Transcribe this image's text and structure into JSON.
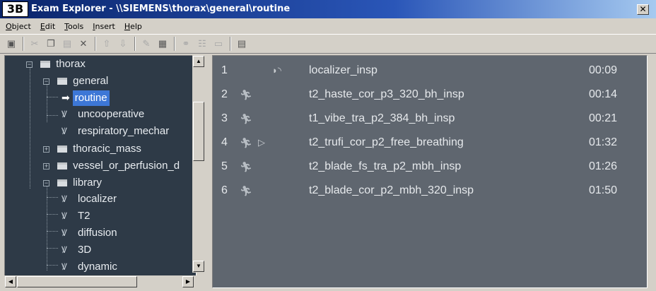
{
  "figure_label": "3B",
  "window": {
    "title": "Exam Explorer - \\\\SIEMENS\\thorax\\general\\routine",
    "close_label": "✕"
  },
  "menu": [
    "Object",
    "Edit",
    "Tools",
    "Insert",
    "Help"
  ],
  "tree": {
    "items": [
      {
        "label": "thorax",
        "type": "folder",
        "expander": "−"
      },
      {
        "label": "general",
        "type": "folder",
        "expander": "−"
      },
      {
        "label": "routine",
        "type": "current",
        "selected": true
      },
      {
        "label": "uncooperative",
        "type": "protocol"
      },
      {
        "label": "respiratory_mechar",
        "type": "protocol"
      },
      {
        "label": "thoracic_mass",
        "type": "folder",
        "expander": "+"
      },
      {
        "label": "vessel_or_perfusion_d",
        "type": "folder",
        "expander": "+"
      },
      {
        "label": "library",
        "type": "folder",
        "expander": "−"
      },
      {
        "label": "localizer",
        "type": "protocol"
      },
      {
        "label": "T2",
        "type": "protocol"
      },
      {
        "label": "diffusion",
        "type": "protocol"
      },
      {
        "label": "3D",
        "type": "protocol"
      },
      {
        "label": "dynamic",
        "type": "protocol"
      }
    ]
  },
  "protocols": [
    {
      "num": "1",
      "icon": "speaker-icon",
      "play": false,
      "name": "localizer_insp",
      "time": "00:09"
    },
    {
      "num": "2",
      "icon": "patient-icon",
      "play": false,
      "name": "t2_haste_cor_p3_320_bh_insp",
      "time": "00:14"
    },
    {
      "num": "3",
      "icon": "patient-icon",
      "play": false,
      "name": "t1_vibe_tra_p2_384_bh_insp",
      "time": "00:21"
    },
    {
      "num": "4",
      "icon": "patient-icon",
      "play": true,
      "name": "t2_trufi_cor_p2_free_breathing",
      "time": "01:32"
    },
    {
      "num": "5",
      "icon": "patient-icon",
      "play": false,
      "name": "t2_blade_fs_tra_p2_mbh_insp",
      "time": "01:26"
    },
    {
      "num": "6",
      "icon": "patient-icon",
      "play": false,
      "name": "t2_blade_cor_p2_mbh_320_insp",
      "time": "01:50"
    }
  ],
  "colors": {
    "tree_bg": "#2e3a47",
    "list_bg": "#5f666f",
    "selection": "#3d77d6"
  }
}
